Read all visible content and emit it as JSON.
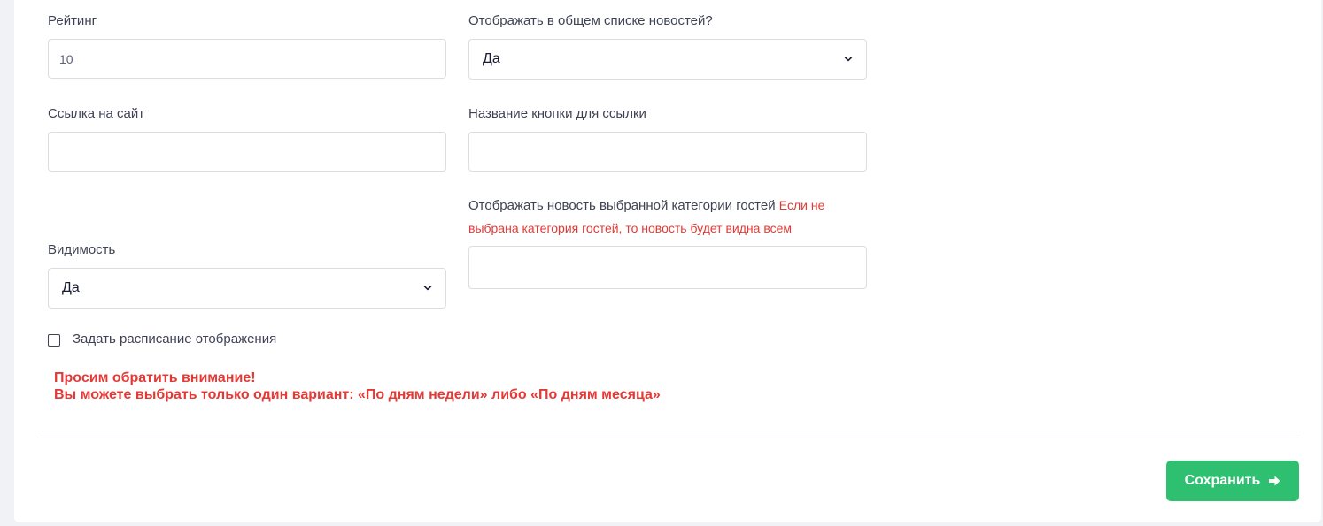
{
  "form": {
    "rating": {
      "label": "Рейтинг",
      "value": "10"
    },
    "show_in_list": {
      "label": "Отображать в общем списке новостей?",
      "selected": "Да"
    },
    "site_link": {
      "label": "Ссылка на сайт",
      "value": ""
    },
    "button_name": {
      "label": "Название кнопки для ссылки",
      "value": ""
    },
    "guest_category": {
      "label": "Отображать новость выбранной категории гостей",
      "note_line1": "Если не",
      "note_line2": "выбрана категория гостей, то новость будет видна всем",
      "value": ""
    },
    "visibility": {
      "label": "Видимость",
      "selected": "Да"
    },
    "schedule": {
      "label": "Задать расписание отображения",
      "checked": false
    },
    "warning": {
      "line1": "Просим обратить внимание!",
      "line2": "Вы можете выбрать только один вариант: «По дням недели» либо «По дням месяца»"
    }
  },
  "footer": {
    "save_label": "Сохранить"
  },
  "colors": {
    "accent_green": "#2ec070",
    "warning_red": "#e53935"
  },
  "icons": {
    "select_arrow": "chevron-down-icon",
    "save_arrow": "arrow-right-icon"
  }
}
